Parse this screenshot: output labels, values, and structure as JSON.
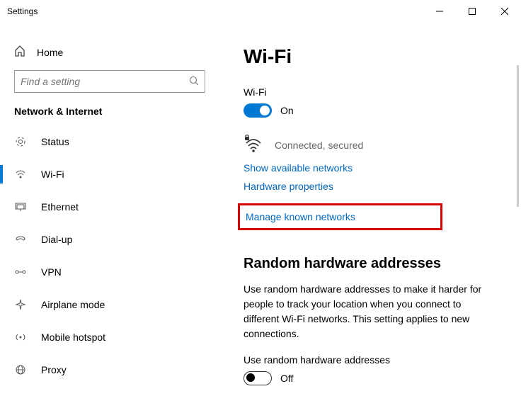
{
  "window": {
    "title": "Settings"
  },
  "sidebar": {
    "home": "Home",
    "search_placeholder": "Find a setting",
    "category": "Network & Internet",
    "items": [
      {
        "label": "Status"
      },
      {
        "label": "Wi-Fi"
      },
      {
        "label": "Ethernet"
      },
      {
        "label": "Dial-up"
      },
      {
        "label": "VPN"
      },
      {
        "label": "Airplane mode"
      },
      {
        "label": "Mobile hotspot"
      },
      {
        "label": "Proxy"
      }
    ]
  },
  "content": {
    "heading": "Wi-Fi",
    "wifi_label": "Wi-Fi",
    "wifi_state": "On",
    "connection_status": "Connected, secured",
    "link_show_networks": "Show available networks",
    "link_hardware_props": "Hardware properties",
    "link_manage_known": "Manage known networks",
    "random_heading": "Random hardware addresses",
    "random_body": "Use random hardware addresses to make it harder for people to track your location when you connect to different Wi-Fi networks. This setting applies to new connections.",
    "random_label": "Use random hardware addresses",
    "random_state": "Off"
  }
}
